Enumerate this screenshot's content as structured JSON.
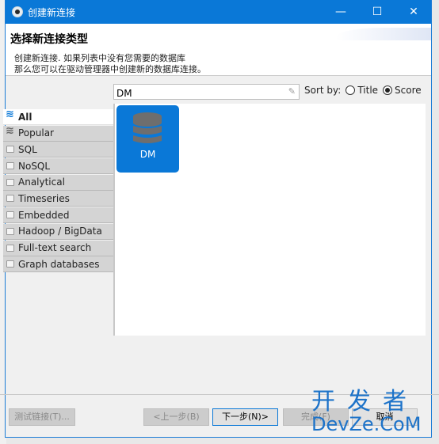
{
  "window": {
    "title": "创建新连接",
    "controls": {
      "minimize": "—",
      "maximize": "☐",
      "close": "✕"
    }
  },
  "header": {
    "heading": "选择新连接类型",
    "description_line1": "创建新连接. 如果列表中没有您需要的数据库",
    "description_line2": "那么您可以在驱动管理器中创建新的数据库连接。"
  },
  "search": {
    "value": "DM",
    "placeholder": "",
    "clear_icon": "✎"
  },
  "sort": {
    "label": "Sort by:",
    "options": [
      {
        "label": "Title",
        "selected": false
      },
      {
        "label": "Score",
        "selected": true
      }
    ]
  },
  "categories": [
    {
      "label": "All",
      "icon": "database-icon",
      "active": true
    },
    {
      "label": "Popular",
      "icon": "database-icon",
      "active": false
    },
    {
      "label": "SQL",
      "icon": "folder-icon",
      "active": false
    },
    {
      "label": "NoSQL",
      "icon": "folder-icon",
      "active": false
    },
    {
      "label": "Analytical",
      "icon": "folder-icon",
      "active": false
    },
    {
      "label": "Timeseries",
      "icon": "folder-icon",
      "active": false
    },
    {
      "label": "Embedded",
      "icon": "folder-icon",
      "active": false
    },
    {
      "label": "Hadoop / BigData",
      "icon": "folder-icon",
      "active": false
    },
    {
      "label": "Full-text search",
      "icon": "folder-icon",
      "active": false
    },
    {
      "label": "Graph databases",
      "icon": "folder-icon",
      "active": false
    }
  ],
  "drivers": [
    {
      "label": "DM",
      "icon": "database-icon",
      "selected": true
    }
  ],
  "footer": {
    "test_connection": "测试链接(T)...",
    "back": "<上一步(B)",
    "next": "下一步(N)>",
    "finish": "完成(F)",
    "cancel": "取消"
  },
  "watermark": {
    "line1": "开发者",
    "line2": "DevZe.CoM"
  },
  "colors": {
    "accent": "#0a78d7",
    "category_bg": "#d4d4d4",
    "window_bg": "#f0f0f0"
  }
}
